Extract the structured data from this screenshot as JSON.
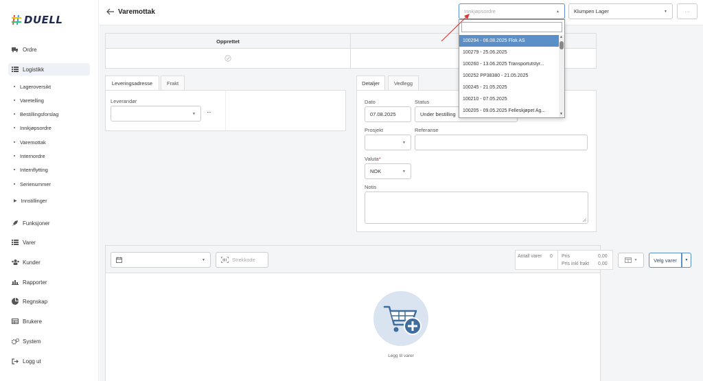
{
  "brand": {
    "name": "DUELL"
  },
  "sidebar": {
    "items": [
      {
        "label": "Ordre",
        "icon": "truck-icon"
      },
      {
        "label": "Logistikk",
        "icon": "list-icon"
      },
      {
        "label": "Funksjoner",
        "icon": "rocket-icon"
      },
      {
        "label": "Varer",
        "icon": "list-icon"
      },
      {
        "label": "Kunder",
        "icon": "users-icon"
      },
      {
        "label": "Rapporter",
        "icon": "bar-chart-icon"
      },
      {
        "label": "Regnskap",
        "icon": "pie-chart-icon"
      },
      {
        "label": "Brukere",
        "icon": "table-icon"
      },
      {
        "label": "System",
        "icon": "gears-icon"
      },
      {
        "label": "Logg ut",
        "icon": "logout-icon"
      }
    ],
    "subitems": [
      "Lageroversikt",
      "Varetelling",
      "Bestillingsforslag",
      "Innkjøpsordre",
      "Varemottak",
      "Internordre",
      "Internflytting",
      "Serienummer",
      "Innstillinger"
    ]
  },
  "header": {
    "title": "Varemottak",
    "purchase_order_placeholder": "Innkjøpsordre",
    "warehouse": "Klumpen Lager",
    "more": "···"
  },
  "status_bar": {
    "step1": "Opprettet"
  },
  "dropdown": {
    "options": [
      "100294 - 06.08.2025 Flok AS",
      "100279 - 25.06.2025",
      "100260 - 13.06.2025 Transportutstyr...",
      "100252 PP38380 - 21.05.2025",
      "100245 - 21.05.2025",
      "100210 - 07.05.2025",
      "100205 - 09.05.2025 Felleskjøpet Ag..."
    ]
  },
  "left_panel": {
    "tabs": [
      "Leveringsadresse",
      "Frakt"
    ],
    "supplier_label": "Leverandør",
    "dots": "···"
  },
  "right_panel": {
    "tabs": [
      "Detaljer",
      "Vedlegg"
    ],
    "date_label": "Dato",
    "date_value": "07.08.2025",
    "status_label": "Status",
    "status_value": "Under bestilling",
    "project_label": "Prosjekt",
    "reference_label": "Referanse",
    "currency_label": "Valuta",
    "required_mark": "*",
    "currency_value": "NOK",
    "notes_label": "Notis"
  },
  "items_section": {
    "barcode_placeholder": "Strekkode",
    "count_label": "Antall varer",
    "count_value": "0",
    "price_label": "Pris",
    "price_value": "0,00",
    "price_freight_label": "Pris inkl frakt",
    "price_freight_value": "0,00",
    "choose_items": "Velg varer",
    "empty_text": "Legg til varer"
  },
  "colors": {
    "accent": "#5b8fc7",
    "navy": "#1f2a4d",
    "arrow": "#d63a3a"
  }
}
